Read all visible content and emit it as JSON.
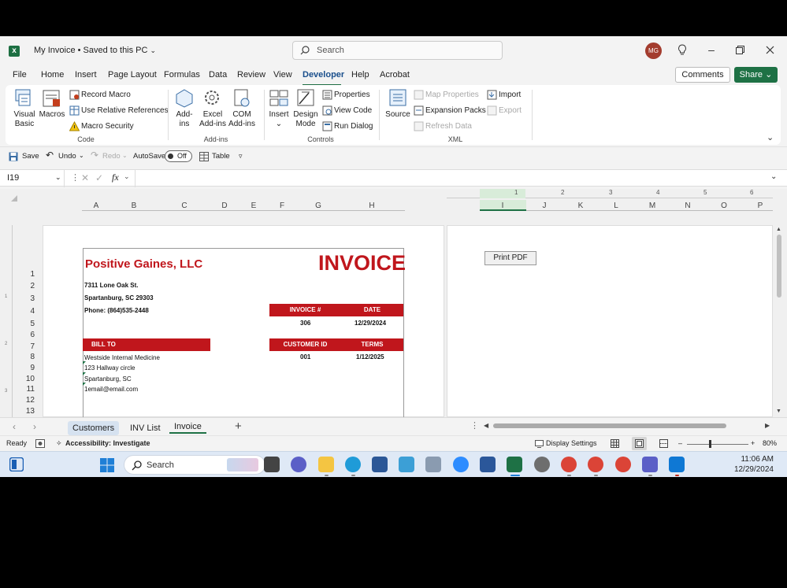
{
  "title_bar": {
    "doc_title": "My Invoice • Saved to this PC",
    "search_placeholder": "Search",
    "avatar_initials": "MG"
  },
  "menu": [
    "File",
    "Home",
    "Insert",
    "Page Layout",
    "Formulas",
    "Data",
    "Review",
    "View",
    "Developer",
    "Help",
    "Acrobat"
  ],
  "menu_active": "Developer",
  "buttons": {
    "comments": "Comments",
    "share": "Share"
  },
  "ribbon": {
    "code": {
      "visual_basic": [
        "Visual",
        "Basic"
      ],
      "macros": "Macros",
      "record_macro": "Record Macro",
      "relative_refs": "Use Relative References",
      "macro_security": "Macro Security",
      "group": "Code"
    },
    "addins": {
      "addins": [
        "Add-",
        "ins"
      ],
      "excel_addins": [
        "Excel",
        "Add-ins"
      ],
      "com_addins": [
        "COM",
        "Add-ins"
      ],
      "group": "Add-ins"
    },
    "controls": {
      "insert": "Insert",
      "design_mode": [
        "Design",
        "Mode"
      ],
      "properties": "Properties",
      "view_code": "View Code",
      "run_dialog": "Run Dialog",
      "group": "Controls"
    },
    "xml": {
      "source": "Source",
      "map_properties": "Map Properties",
      "expansion_packs": "Expansion Packs",
      "refresh_data": "Refresh Data",
      "import": "Import",
      "export": "Export",
      "group": "XML"
    }
  },
  "qat": {
    "save": "Save",
    "undo": "Undo",
    "redo": "Redo",
    "autosave": "AutoSave",
    "autosave_state": "Off",
    "table": "Table"
  },
  "formula_bar": {
    "name_box": "I19",
    "fx": "fx",
    "value": ""
  },
  "columns_left": [
    "A",
    "B",
    "C",
    "D",
    "E",
    "F",
    "G",
    "H"
  ],
  "columns_right": [
    "I",
    "J",
    "K",
    "L",
    "M",
    "N",
    "O",
    "P"
  ],
  "rows": [
    "1",
    "2",
    "3",
    "4",
    "5",
    "6",
    "7",
    "8",
    "9",
    "10",
    "11",
    "12",
    "13"
  ],
  "ruler": [
    "1",
    "2",
    "3",
    "4",
    "5",
    "6"
  ],
  "invoice": {
    "company": "Positive Gaines, LLC",
    "heading": "INVOICE",
    "address1": "7311 Lone Oak St.",
    "address2": "Spartanburg, SC 29303",
    "phone": "Phone: (864)535-2448",
    "inv_no_label": "INVOICE #",
    "date_label": "DATE",
    "inv_no": "306",
    "date": "12/29/2024",
    "bill_to_label": "BILL TO",
    "cust_id_label": "CUSTOMER ID",
    "terms_label": "TERMS",
    "cust_id": "001",
    "terms": "1/12/2025",
    "bill_to": [
      "Westside Internal Medicine",
      "123 Hallway circle",
      "Spartanburg, SC",
      "1email@email.com"
    ]
  },
  "print_pdf": "Print PDF",
  "sheet_tabs": [
    "Customers",
    "INV List",
    "Invoice"
  ],
  "active_sheet": "Invoice",
  "status": {
    "ready": "Ready",
    "accessibility": "Accessibility: Investigate",
    "display_settings": "Display Settings",
    "zoom": "80%",
    "zoom_level": 0.8
  },
  "taskbar": {
    "search": "Search",
    "time": "11:06 AM",
    "date": "12/29/2024"
  },
  "colors": {
    "invoice_red": "#c0161c",
    "excel_green": "#1e7145",
    "accent_blue": "#1a4f8c"
  }
}
